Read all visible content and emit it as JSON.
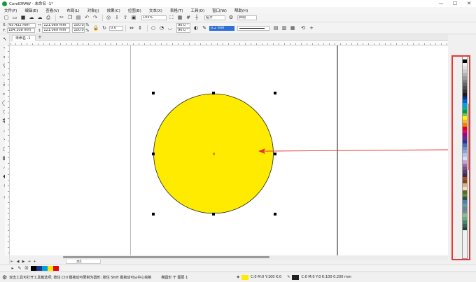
{
  "titlebar": {
    "title": "CorelDRAW - 未命名 -1*",
    "minimize": "—",
    "maximize": "☐",
    "close": "✕"
  },
  "menubar": {
    "items": [
      "文件(F)",
      "编辑(E)",
      "查看(V)",
      "布局(L)",
      "对象(J)",
      "效果(C)",
      "位图(B)",
      "文本(X)",
      "表格(T)",
      "工具(O)",
      "窗口(W)",
      "帮助(H)"
    ]
  },
  "toolbar1": {
    "zoom": "105%",
    "snap_label": "贴齐",
    "launch_label": "启动"
  },
  "toolbar2": {
    "x_label": "X:",
    "x_value": "65.432 mm",
    "y_label": "Y:",
    "y_value": "184.308 mm",
    "w_value": "121.069 mm",
    "h_value": "121.069 mm",
    "scale_x": "100.0",
    "scale_y": "100.0",
    "pct": "%",
    "rotation": "0.0",
    "angle_start": "90.0 °",
    "angle_end": "90.0 °",
    "outline_width": "0.2 mm"
  },
  "document_tab": {
    "label": "未命名 -1",
    "add": "+"
  },
  "page_navigator": {
    "page_tab": "页1"
  },
  "colors": {
    "circle_fill": "#ffeb00",
    "circle_stroke": "#222222",
    "arrow": "#e53935",
    "highlight": "#e53935",
    "palette": [
      "#ffffff",
      "#000000",
      "#f2f2f2",
      "#e0e0e0",
      "#cccccc",
      "#b3b3b3",
      "#999999",
      "#808080",
      "#666666",
      "#4d4d4d",
      "#333333",
      "#1a1a1a",
      "#003399",
      "#0066cc",
      "#00a0e9",
      "#00b0a0",
      "#009944",
      "#7cc242",
      "#fff100",
      "#f7b52c",
      "#f08300",
      "#e60012",
      "#e4007f",
      "#a40080",
      "#5f2c91",
      "#2e3192",
      "#4b6cb7",
      "#6d8dc6",
      "#8aa4d6",
      "#b3c4e8",
      "#d6e0f5",
      "#c8a2c8",
      "#9b6fae",
      "#7d4e8f",
      "#5a3d6e",
      "#3d2a4e",
      "#a0522d",
      "#8b4513",
      "#d2b48c",
      "#f5deb3",
      "#556b2f",
      "#6b8e23",
      "#2f4f4f",
      "#4682b4",
      "#5f9ea0",
      "#708090",
      "#778899",
      "#8fbc8f",
      "#66aa88",
      "#448866",
      "#336655",
      "#224433"
    ],
    "doc_palette": [
      "#000000",
      "#1a3a8a",
      "#009de0",
      "#ffe600",
      "#e30613"
    ]
  },
  "statusbar": {
    "hint": "双击工具可打开工具箱选项; 按住 Ctrl 键拖动可限制为圆形; 按住 Shift 键拖动可从中心绘制",
    "object_info": "椭圆形 于 图层 1",
    "fill_label": "C:0 M:0 Y:100 K:0",
    "outline_label": "C:0 M:0 Y:0 K:100  0.200 mm"
  }
}
